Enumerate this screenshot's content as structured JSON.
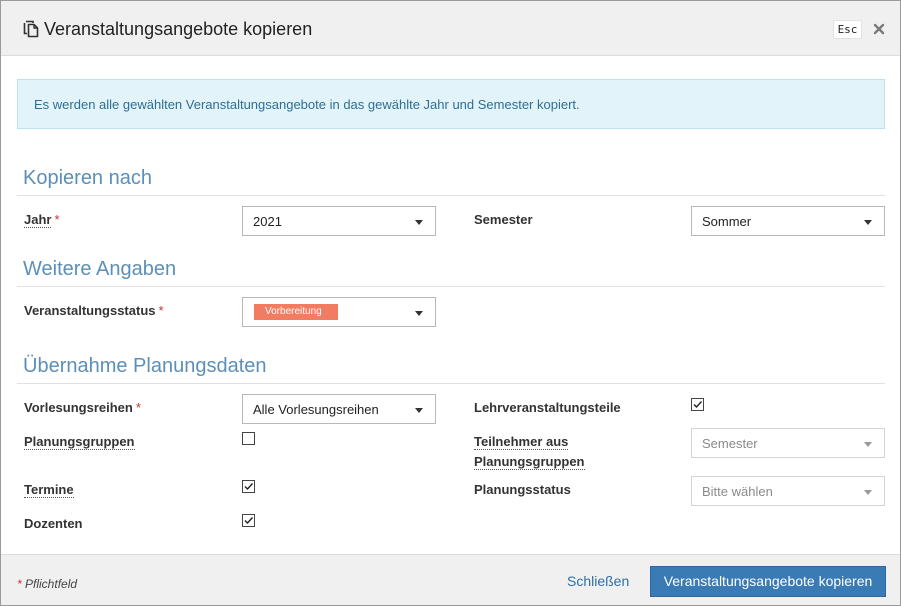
{
  "dialog": {
    "title": "Veranstaltungsangebote kopieren",
    "esc_label": "Esc",
    "info_text": "Es werden alle gewählten Veranstaltungsangebote in das gewählte Jahr und Semester kopiert."
  },
  "sections": {
    "copy_to": "Kopieren nach",
    "further": "Weitere Angaben",
    "planning": "Übernahme Planungsdaten"
  },
  "fields": {
    "year": {
      "label": "Jahr",
      "required": "*",
      "value": "2021"
    },
    "semester": {
      "label": "Semester",
      "value": "Sommer"
    },
    "status": {
      "label": "Veranstaltungsstatus",
      "required": "*",
      "badge": "Vorbereitung",
      "badge_color": "#f27c61"
    },
    "lecture_series": {
      "label": "Vorlesungsreihen",
      "required": "*",
      "value": "Alle Vorlesungsreihen"
    },
    "course_parts": {
      "label": "Lehrveranstaltungsteile",
      "checked": true
    },
    "planning_groups": {
      "label": "Planungsgruppen",
      "checked": false
    },
    "participants": {
      "label_line1": "Teilnehmer aus",
      "label_line2": "Planungsgruppen",
      "value": "Semester",
      "disabled": true
    },
    "appointments": {
      "label": "Termine",
      "checked": true
    },
    "planning_status": {
      "label": "Planungsstatus",
      "value": "Bitte wählen",
      "disabled": true
    },
    "lecturers": {
      "label": "Dozenten",
      "checked": true
    }
  },
  "footer": {
    "required_star": "*",
    "required_note": "Pflichtfeld",
    "close_label": "Schließen",
    "submit_label": "Veranstaltungsangebote kopieren"
  },
  "colors": {
    "accent": "#3a7ab5",
    "section_title": "#5b8fb8",
    "info_bg": "#e2f3fa",
    "required": "#c9302c"
  },
  "icons": {
    "title": "copy-icon",
    "close": "close-icon",
    "checkbox_check": "check-icon",
    "select_caret": "caret-down-icon"
  }
}
